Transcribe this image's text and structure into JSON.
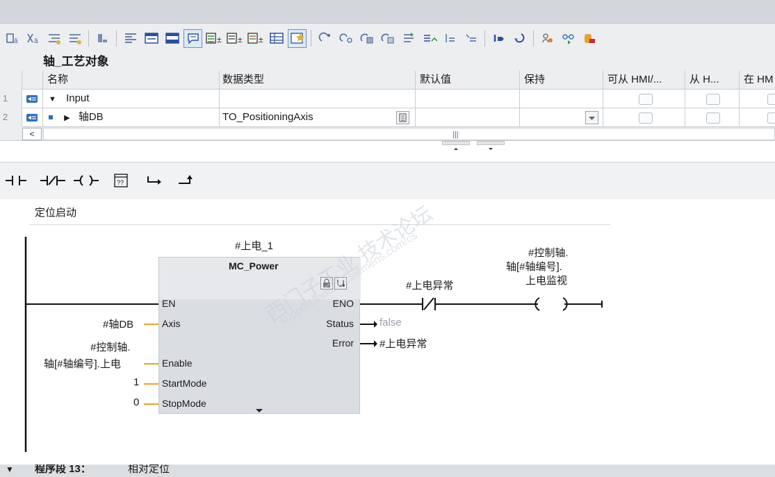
{
  "toolbar": {
    "icons": [
      "insert-row-icon",
      "add-row-icon",
      "indent-icon",
      "outdent-icon",
      "monitor-icon",
      "list-view-icon",
      "lad-icon",
      "fbd-icon",
      "stl-icon",
      "comment-icon",
      "add-address-icon",
      "add-symbol-icon",
      "add-both-icon",
      "table-icon",
      "favorite-icon",
      "goto-icon",
      "jump-icon",
      "compare-icon",
      "compare2-icon",
      "branch-icon",
      "network-up-icon",
      "network-down-icon",
      "expand-icon",
      "nav-back-icon",
      "nav-fwd-icon",
      "monitor-on-icon",
      "glasses-icon",
      "db-icon"
    ]
  },
  "block": {
    "title": "轴_工艺对象"
  },
  "interface": {
    "columns": [
      "名称",
      "数据类型",
      "默认值",
      "保持",
      "可从 HMI/...",
      "从 H...",
      "在 HM"
    ],
    "rows": [
      {
        "num": "1",
        "name": "Input",
        "type": ""
      },
      {
        "num": "2",
        "name": "轴DB",
        "type": "TO_PositioningAxis"
      }
    ],
    "scroll_mark": "|||"
  },
  "instructions": [
    "normally-open-contact",
    "normally-closed-contact",
    "coil",
    "empty-box",
    "open-branch",
    "close-branch"
  ],
  "network": {
    "comment": "定位启动",
    "instance": "#上电_1",
    "block_name": "MC_Power",
    "pins_left": [
      "EN",
      "Axis",
      "Enable",
      "StartMode",
      "StopMode"
    ],
    "pins_right": [
      "ENO",
      "Status",
      "Error"
    ],
    "param_axis": "#轴DB",
    "param_enable_1": "#控制轴.",
    "param_enable_2": "轴[#轴编号].上电",
    "param_startmode": "1",
    "param_stopmode": "0",
    "out_status": "false",
    "out_error": "#上电异常",
    "contact_label": "#上电异常",
    "coil_label_1": "#控制轴.",
    "coil_label_2": "轴[#轴编号].",
    "coil_label_3": "上电监视"
  },
  "watermark": {
    "line1": "西门子工业 技术论坛",
    "line2": "support.industry.siemens.com/cs"
  },
  "footer": {
    "label": "程序段 13：",
    "title": "相对定位"
  },
  "colors": {
    "param_line": "#f0a020",
    "block_fill": "#dadde2",
    "active_icon": "#6b8fc4"
  }
}
